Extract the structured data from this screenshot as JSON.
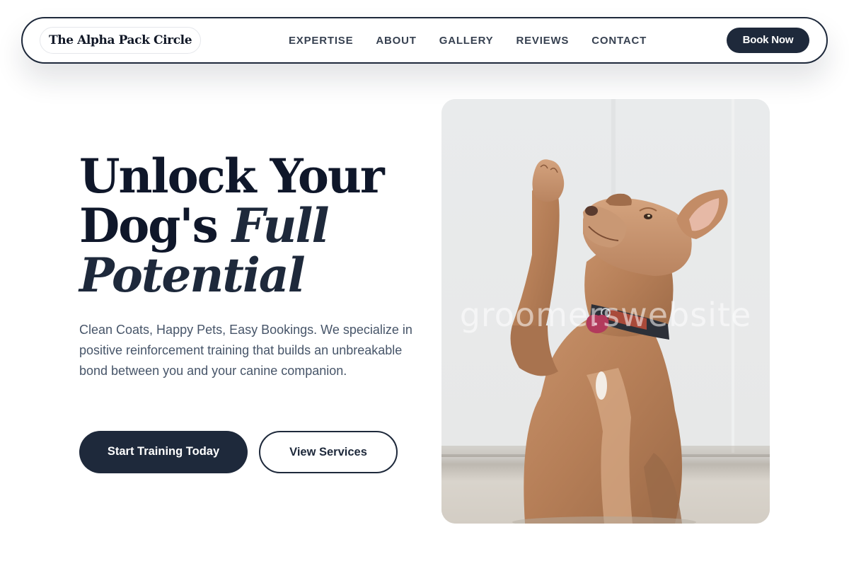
{
  "navbar": {
    "brand": "The Alpha Pack Circle",
    "links": [
      {
        "label": "EXPERTISE"
      },
      {
        "label": "ABOUT"
      },
      {
        "label": "GALLERY"
      },
      {
        "label": "REVIEWS"
      },
      {
        "label": "CONTACT"
      }
    ],
    "cta_label": "Book Now"
  },
  "hero": {
    "title_line1": "Unlock Your",
    "title_line2_plain": "Dog's ",
    "title_line2_italic": "Full",
    "title_line3_italic": "Potential",
    "subtitle": "Clean Coats, Happy Pets, Easy Bookings. We specialize in positive reinforcement training that builds an unbreakable bond between you and your canine companion.",
    "primary_button": "Start Training Today",
    "secondary_button": "View Services",
    "image": {
      "subject": "tan dog raising paw",
      "watermark": "groomerswebsite"
    }
  },
  "colors": {
    "navy": "#1e293b",
    "heading": "#0f172a",
    "body_text": "#475569",
    "nav_text": "#374151",
    "background": "#ffffff"
  }
}
